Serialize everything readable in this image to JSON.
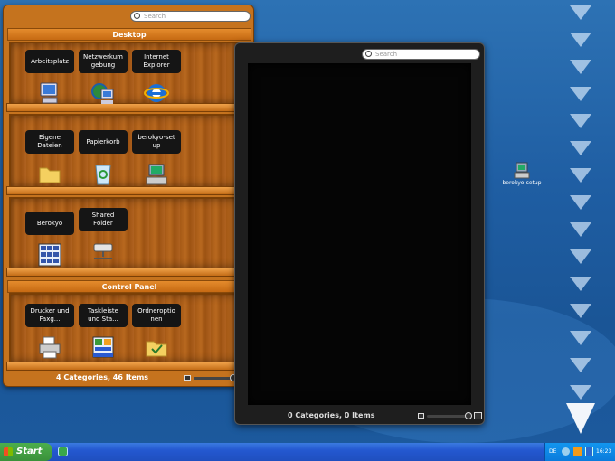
{
  "shelf_window": {
    "search_placeholder": "Search",
    "sections": [
      {
        "title": "Desktop",
        "rows": [
          [
            {
              "label": "Arbeitsplatz",
              "icon": "computer-icon"
            },
            {
              "label": "Netzwerkum\ngebung",
              "icon": "network-icon"
            },
            {
              "label": "Internet\nExplorer",
              "icon": "internet-explorer-icon"
            }
          ],
          [
            {
              "label": "Eigene\nDateien",
              "icon": "folder-icon"
            },
            {
              "label": "Papierkorb",
              "icon": "recycle-bin-icon"
            },
            {
              "label": "berokyo-set\nup",
              "icon": "setup-icon"
            }
          ],
          [
            {
              "label": "Berokyo",
              "icon": "berokyo-icon"
            },
            {
              "label": "Shared\nFolder",
              "icon": "shared-drive-icon"
            }
          ]
        ]
      },
      {
        "title": "Control Panel",
        "rows": [
          [
            {
              "label": "Drucker und\nFaxg...",
              "icon": "printer-icon"
            },
            {
              "label": "Taskleiste\nund Sta...",
              "icon": "taskbar-settings-icon"
            },
            {
              "label": "Ordneroptio\nnen",
              "icon": "folder-options-icon"
            }
          ]
        ]
      }
    ],
    "status": "4 Categories, 46 Items"
  },
  "dark_window": {
    "search_placeholder": "Search",
    "status": "0 Categories, 0 Items"
  },
  "desktop_icon": {
    "label": "berokyo-setup",
    "icon": "setup-icon"
  },
  "taskbar": {
    "start_label": "Start",
    "language": "DE",
    "clock": "16:23"
  }
}
